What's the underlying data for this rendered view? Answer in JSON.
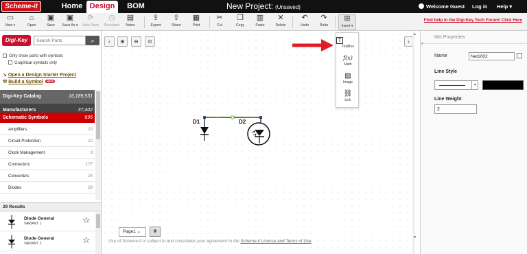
{
  "nav": {
    "logo": "Scheme-it",
    "home": "Home",
    "design": "Design",
    "bom": "BOM",
    "project_title": "New Project:",
    "project_status": "(Unsaved)",
    "welcome": "Welcome Guest",
    "login": "Log in",
    "help": "Help",
    "help_caret": "▾",
    "menu_icon": "▾"
  },
  "toolbar": {
    "items": [
      {
        "label": "New ▾",
        "icon": "new-file-icon",
        "glyph": "▭"
      },
      {
        "label": "Open",
        "icon": "folder-open-icon",
        "glyph": "⌂"
      },
      {
        "label": "Save",
        "icon": "save-icon",
        "glyph": "▣"
      },
      {
        "label": "Save As ▾",
        "icon": "save-as-icon",
        "glyph": "▣"
      },
      {
        "label": "Auto Save",
        "icon": "autosave-icon",
        "glyph": "⟳"
      },
      {
        "label": "Revisions",
        "icon": "revisions-icon",
        "glyph": "◷"
      },
      {
        "label": "Notes",
        "icon": "notes-icon",
        "glyph": "▤"
      },
      {
        "label": "Export",
        "icon": "export-icon",
        "glyph": "⇪"
      },
      {
        "label": "Share",
        "icon": "share-icon",
        "glyph": "⇧"
      },
      {
        "label": "Print",
        "icon": "print-icon",
        "glyph": "▦"
      },
      {
        "label": "Cut",
        "icon": "cut-icon",
        "glyph": "✂"
      },
      {
        "label": "Copy",
        "icon": "copy-icon",
        "glyph": "❐"
      },
      {
        "label": "Paste",
        "icon": "paste-icon",
        "glyph": "▥"
      },
      {
        "label": "Delete",
        "icon": "delete-icon",
        "glyph": "✕"
      },
      {
        "label": "Undo",
        "icon": "undo-icon",
        "glyph": "↶"
      },
      {
        "label": "Redo",
        "icon": "redo-icon",
        "glyph": "↷"
      },
      {
        "label": "Insert ▾",
        "icon": "insert-icon",
        "glyph": "⊞"
      }
    ],
    "help_link": "Find help in the Digi-Key Tech Forum! Click Here"
  },
  "left": {
    "logo": "Digi-Key",
    "search_placeholder": "Search Parts",
    "search_icon": "search-icon",
    "search_glyph": "⌕",
    "only_parts": "Only show parts with symbols",
    "graphical_only": "Graphical symbols only",
    "starter_project": "Open a Design Starter Project",
    "build_symbol": "Build a Symbol",
    "new_badge": "NEW",
    "link_glyph": "↘",
    "build_glyph": "⚒",
    "catalog": {
      "label": "Digi-Key Catalog",
      "count": "16,189,531"
    },
    "manufacturers": {
      "label": "Manufacturers",
      "count": "37,402"
    },
    "schematic_symbols": {
      "label": "Schematic Symbols",
      "count": "695"
    },
    "symbol_groups": [
      {
        "label": "Amplifiers",
        "count": "10"
      },
      {
        "label": "Circuit Protection",
        "count": "12"
      },
      {
        "label": "Clock Management",
        "count": "3"
      },
      {
        "label": "Connectors",
        "count": "177"
      },
      {
        "label": "Converters",
        "count": "15"
      },
      {
        "label": "Diodes",
        "count": "29"
      }
    ],
    "results_count": "29 Results",
    "results": [
      {
        "name": "Diode General",
        "variant": "VARIANT 1"
      },
      {
        "name": "Diode General",
        "variant": "VARIANT 2"
      }
    ],
    "star_glyph": "☆"
  },
  "canvas": {
    "collapse_left": "‹",
    "collapse_right": "›",
    "zoom_in": "⊕",
    "zoom_out": "⊖",
    "zoom_fit": "⊙",
    "scroll_up": "▲",
    "scroll_down": "▼",
    "page_tab": "Page1 ⌄",
    "add_page": "+",
    "footer_pre": "Use of Scheme-it is subject to and constitutes your agreement to the ",
    "footer_link": "Scheme-it License and Terms of Use",
    "d1_label": "D1",
    "d2_label": "D2"
  },
  "insert_menu": {
    "items": [
      {
        "label": "TextBox",
        "icon": "textbox-icon",
        "glyph": "T"
      },
      {
        "label": "Math",
        "icon": "math-icon",
        "glyph": "f(x)"
      },
      {
        "label": "Image",
        "icon": "image-icon",
        "glyph": "▨"
      },
      {
        "label": "Link",
        "icon": "link-icon",
        "glyph": "⛓"
      }
    ]
  },
  "right": {
    "collapse_glyph": "›",
    "title": "Net Properties",
    "name_label": "Name",
    "name_value": "Net1002",
    "line_style_label": "Line Style",
    "line_color": "#000000",
    "line_weight_label": "Line Weight",
    "line_weight_value": "2",
    "select_caret": "▾"
  },
  "colors": {
    "accent_red": "#c8102e",
    "net_highlight": "#66aa22",
    "arrow": "#e01b24"
  }
}
